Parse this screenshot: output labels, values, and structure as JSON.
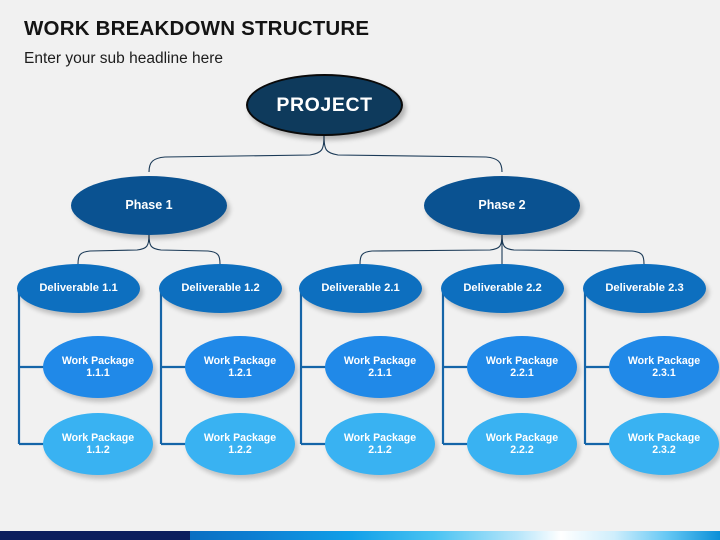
{
  "header": {
    "title": "WORK BREAKDOWN STRUCTURE",
    "subtitle": "Enter your sub headline here"
  },
  "colors": {
    "background": "#f1f1f1",
    "project": "#0e3a5c",
    "phase": "#0a5291",
    "deliverable": "#0d6fbf",
    "work_package_row1": "#2089e8",
    "work_package_row2": "#39b2f2",
    "curve_connector": "#1b3a57",
    "elbow_connector": "#1565a8",
    "bar_navy": "#0c1e5e",
    "bar_gradient_start": "#0a6fc2",
    "bar_gradient_end": "#0a8fd8",
    "node_text": "#ffffff",
    "title_text": "#141414"
  },
  "diagram": {
    "root": {
      "label": "PROJECT"
    },
    "phases": [
      {
        "label": "Phase 1"
      },
      {
        "label": "Phase 2"
      }
    ],
    "deliverables": [
      {
        "label": "Deliverable 1.1"
      },
      {
        "label": "Deliverable 1.2"
      },
      {
        "label": "Deliverable 2.1"
      },
      {
        "label": "Deliverable 2.2"
      },
      {
        "label": "Deliverable 2.3"
      }
    ],
    "work_packages_row1": [
      {
        "label": "Work Package\n1.1.1"
      },
      {
        "label": "Work Package\n1.2.1"
      },
      {
        "label": "Work Package\n2.1.1"
      },
      {
        "label": "Work Package\n2.2.1"
      },
      {
        "label": "Work Package\n2.3.1"
      }
    ],
    "work_packages_row2": [
      {
        "label": "Work Package\n1.1.2"
      },
      {
        "label": "Work Package\n1.2.2"
      },
      {
        "label": "Work Package\n2.1.2"
      },
      {
        "label": "Work Package\n2.2.2"
      },
      {
        "label": "Work Package\n2.3.2"
      }
    ]
  }
}
